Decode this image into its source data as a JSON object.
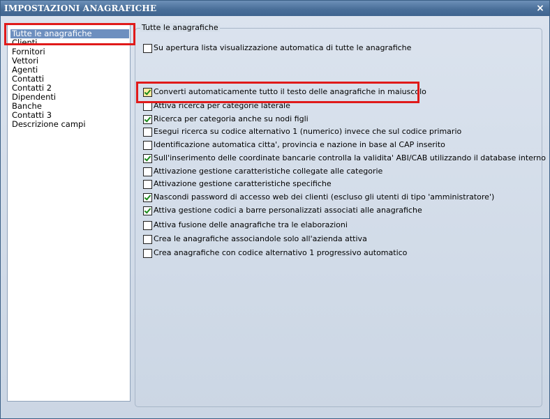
{
  "window": {
    "title": "IMPOSTAZIONI ANAGRAFICHE",
    "close_glyph": "×"
  },
  "sidebar": {
    "items": [
      {
        "label": "Tutte le anagrafiche",
        "selected": true
      },
      {
        "label": "Clienti"
      },
      {
        "label": "Fornitori"
      },
      {
        "label": "Vettori"
      },
      {
        "label": "Agenti"
      },
      {
        "label": "Contatti"
      },
      {
        "label": "Contatti 2"
      },
      {
        "label": "Dipendenti"
      },
      {
        "label": "Banche"
      },
      {
        "label": "Contatti 3"
      },
      {
        "label": "Descrizione campi"
      }
    ]
  },
  "group": {
    "title": "Tutte le anagrafiche"
  },
  "options": [
    {
      "label": "Su apertura lista visualizzazione automatica di tutte le anagrafiche",
      "checked": false
    },
    {
      "label": "Converti automaticamente tutto il testo delle anagrafiche in maiuscolo",
      "checked": true
    },
    {
      "label": "Attiva ricerca per categorie laterale",
      "checked": false
    },
    {
      "label": "Ricerca per categoria anche su nodi figli",
      "checked": true
    },
    {
      "label": "Esegui ricerca su codice alternativo 1 (numerico) invece che sul codice primario",
      "checked": false
    },
    {
      "label": "Identificazione automatica citta', provincia e nazione in base al CAP inserito",
      "checked": false
    },
    {
      "label": "Sull'inserimento delle coordinate bancarie controlla la validita' ABI/CAB utilizzando il database interno",
      "checked": true
    },
    {
      "label": "Attivazione gestione caratteristiche collegate alle categorie",
      "checked": false
    },
    {
      "label": "Attivazione gestione caratteristiche specifiche",
      "checked": false
    },
    {
      "label": "Nascondi password di accesso web dei clienti (escluso gli utenti di tipo 'amministratore')",
      "checked": true
    },
    {
      "label": "Attiva gestione codici a barre personalizzati associati alle anagrafiche",
      "checked": true
    },
    {
      "label": "Attiva fusione delle anagrafiche tra le elaborazioni",
      "checked": false
    },
    {
      "label": "Crea le anagrafiche associandole solo all'azienda attiva",
      "checked": false
    },
    {
      "label": "Crea anagrafiche con codice alternativo 1 progressivo automatico",
      "checked": false
    }
  ],
  "colors": {
    "highlight": "#e01a1a",
    "check": "#1b8a1b",
    "titlebar": "#4a6f99"
  }
}
